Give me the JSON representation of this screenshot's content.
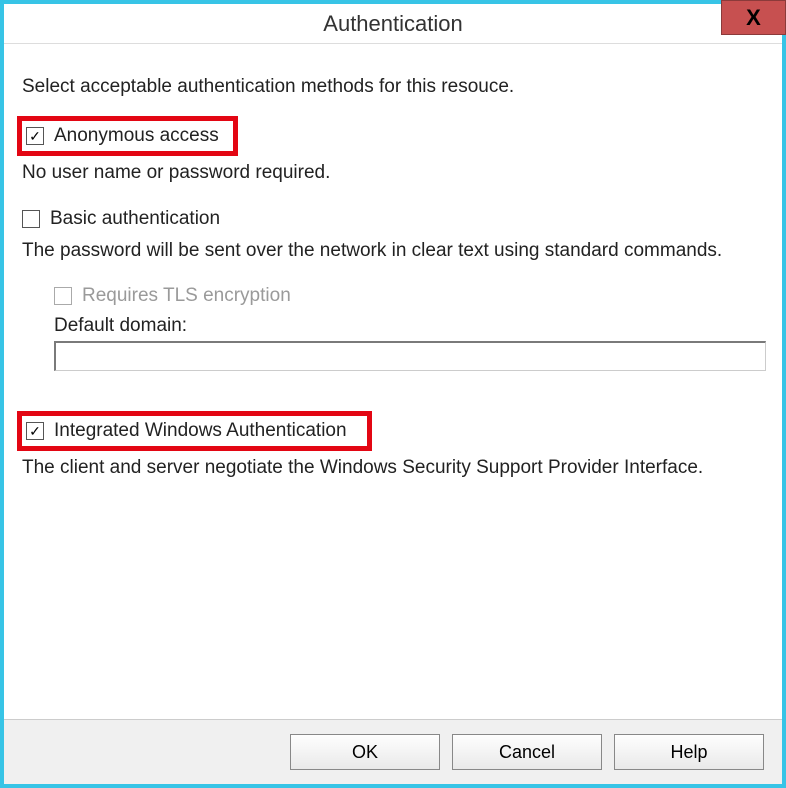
{
  "window": {
    "title": "Authentication",
    "close_label": "X"
  },
  "instruction": "Select acceptable authentication methods for this resouce.",
  "anonymous": {
    "label": "Anonymous access",
    "checked": true,
    "desc": "No user name or password required."
  },
  "basic": {
    "label": "Basic authentication",
    "checked": false,
    "desc": "The password will be sent over the network in clear text using standard commands."
  },
  "tls": {
    "label": "Requires TLS encryption",
    "checked": false,
    "disabled": true
  },
  "domain": {
    "label": "Default domain:",
    "value": ""
  },
  "iwa": {
    "label": "Integrated Windows Authentication",
    "checked": true,
    "desc": "The client and server negotiate the Windows Security Support Provider Interface."
  },
  "buttons": {
    "ok": "OK",
    "cancel": "Cancel",
    "help": "Help"
  }
}
